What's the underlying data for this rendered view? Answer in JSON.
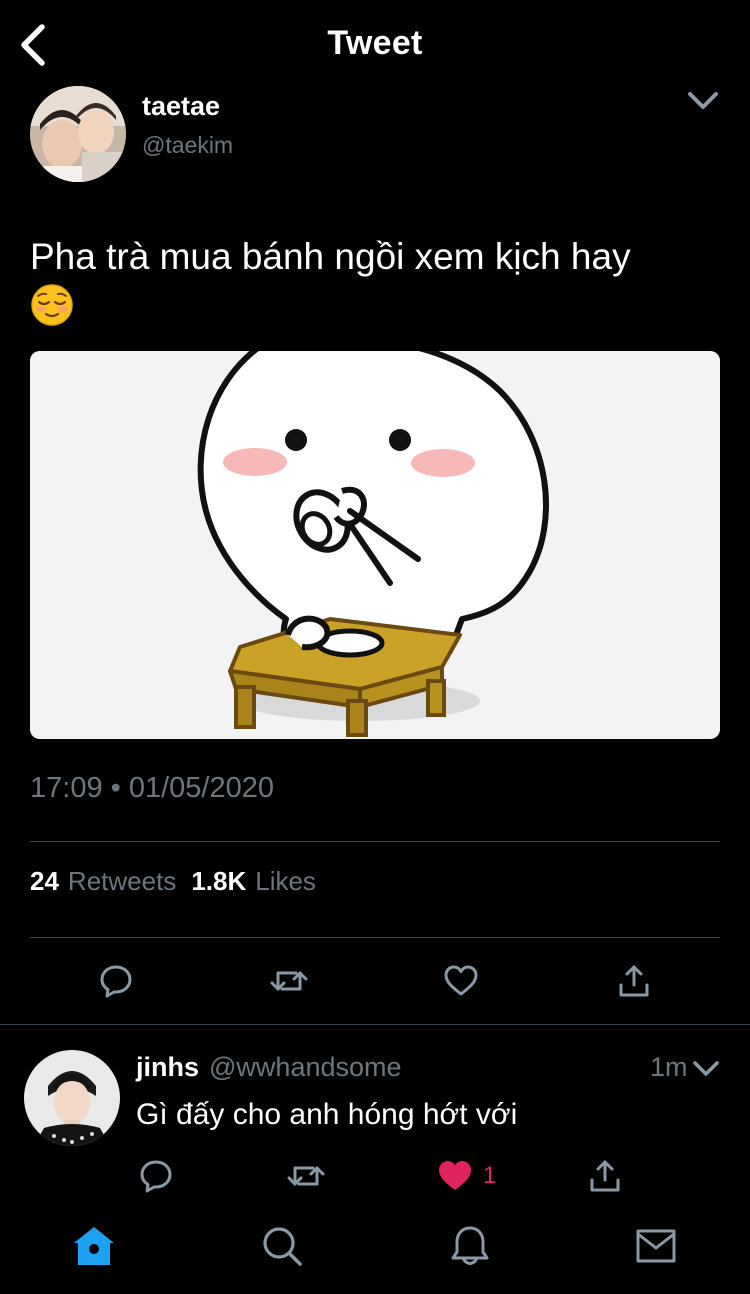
{
  "header": {
    "title": "Tweet",
    "back_icon": "chevron-left-icon"
  },
  "tweet": {
    "author_name": "taetae",
    "author_handle": "@taekim",
    "text": "Pha trà mua bánh ngồi xem kịch hay",
    "emoji": "relieved-face-emoji",
    "media": "sticker-character-drinking-tea-at-low-table",
    "time": "17:09",
    "date_separator": "•",
    "date": "01/05/2020",
    "retweets_count": "24",
    "retweets_label": "Retweets",
    "likes_count": "1.8K",
    "likes_label": "Likes"
  },
  "reply": {
    "name": "jinhs",
    "handle": "@wwhandsome",
    "time": "1m",
    "text": "Gì đấy cho anh hóng hớt với",
    "like_count": "1",
    "liked": true
  },
  "tabs": [
    "home-icon",
    "search-icon",
    "bell-icon",
    "mail-icon"
  ],
  "colors": {
    "background": "#000000",
    "text": "#ffffff",
    "secondary": "#6e767d",
    "divider": "#38444d",
    "accent": "#1da1f2",
    "like": "#e0245e"
  }
}
